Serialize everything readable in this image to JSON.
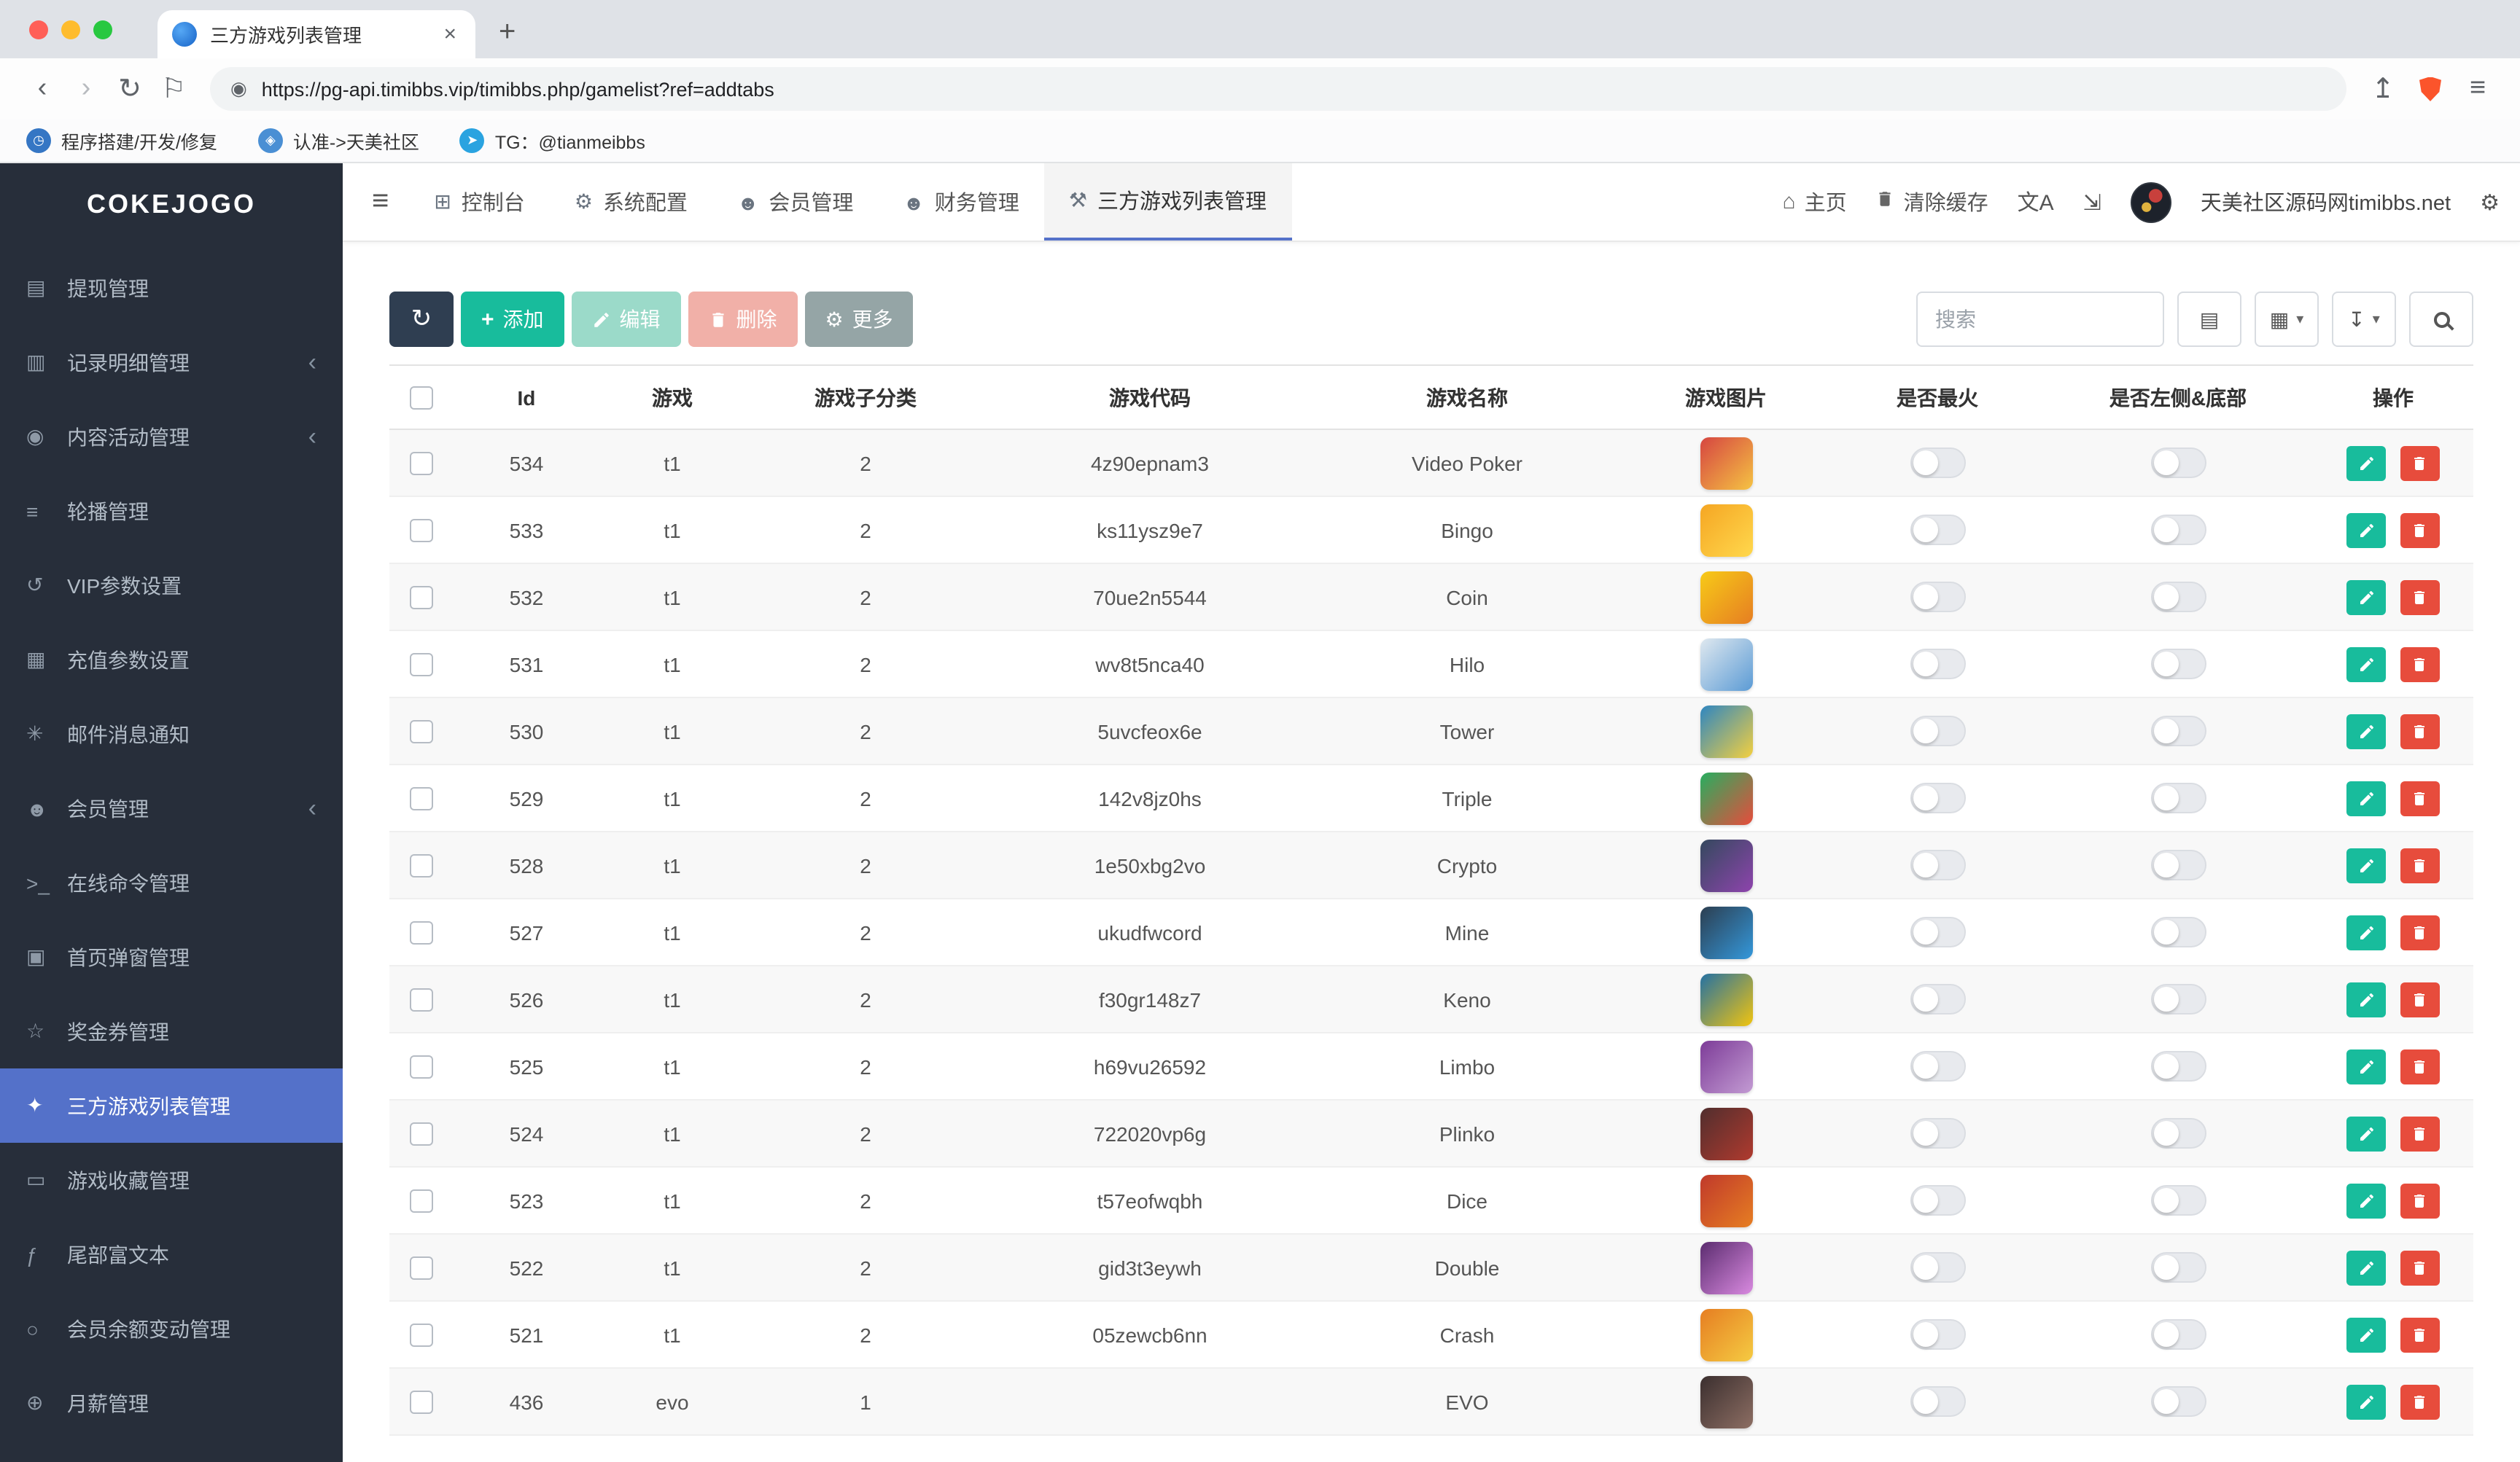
{
  "colors": {
    "accent": "#5471c9",
    "success": "#18bc9c",
    "success-light": "#9bdac9",
    "danger": "#e74c3c",
    "danger-light": "#f1b0a8",
    "gray-btn": "#95a5a6",
    "dark-btn": "#2f3e51",
    "sidebar-bg": "#272e3a",
    "traffic-red": "#ff5f57",
    "traffic-yellow": "#febc2e",
    "traffic-green": "#28c840",
    "shield-orange": "#fb542b"
  },
  "browser": {
    "tab_title": "三方游戏列表管理",
    "url": "https://pg-api.timibbs.vip/timibbs.php/gamelist?ref=addtabs",
    "bookmarks": [
      {
        "label": "程序搭建/开发/修复",
        "color": "#3576c4",
        "glyph": "◷"
      },
      {
        "label": "认准->天美社区",
        "color": "#4a8fd4",
        "glyph": "◈"
      },
      {
        "label": "TG：@tianmeibbs",
        "color": "#2aa3e0",
        "glyph": "➤"
      }
    ]
  },
  "sidebar": {
    "logo": "COKEJOGO",
    "items": [
      {
        "label": "提现管理",
        "icon": "withdraw-icon"
      },
      {
        "label": "记录明细管理",
        "icon": "records-icon",
        "chevron": true
      },
      {
        "label": "内容活动管理",
        "icon": "activity-icon",
        "chevron": true
      },
      {
        "label": "轮播管理",
        "icon": "carousel-icon"
      },
      {
        "label": "VIP参数设置",
        "icon": "vip-icon"
      },
      {
        "label": "充值参数设置",
        "icon": "recharge-icon"
      },
      {
        "label": "邮件消息通知",
        "icon": "mail-icon"
      },
      {
        "label": "会员管理",
        "icon": "members-icon",
        "chevron": true
      },
      {
        "label": "在线命令管理",
        "icon": "terminal-icon"
      },
      {
        "label": "首页弹窗管理",
        "icon": "popup-icon"
      },
      {
        "label": "奖金券管理",
        "icon": "coupon-icon"
      },
      {
        "label": "三方游戏列表管理",
        "icon": "games-icon",
        "active": true
      },
      {
        "label": "游戏收藏管理",
        "icon": "favorites-icon"
      },
      {
        "label": "尾部富文本",
        "icon": "richtext-icon"
      },
      {
        "label": "会员余额变动管理",
        "icon": "balance-icon"
      },
      {
        "label": "月薪管理",
        "icon": "salary-icon"
      }
    ]
  },
  "topnav": {
    "tabs": [
      {
        "label": "控制台",
        "icon": "dashboard-icon"
      },
      {
        "label": "系统配置",
        "icon": "gear-icon"
      },
      {
        "label": "会员管理",
        "icon": "users-icon"
      },
      {
        "label": "财务管理",
        "icon": "finance-icon"
      },
      {
        "label": "三方游戏列表管理",
        "icon": "wrench-icon",
        "active": true
      }
    ],
    "home": "主页",
    "clear_cache": "清除缓存",
    "user": "天美社区源码网timibbs.net"
  },
  "toolbar": {
    "add": "添加",
    "edit": "编辑",
    "delete": "删除",
    "more": "更多",
    "search_placeholder": "搜索"
  },
  "table": {
    "headers": [
      "Id",
      "游戏",
      "游戏子分类",
      "游戏代码",
      "游戏名称",
      "游戏图片",
      "是否最火",
      "是否左侧&底部",
      "操作"
    ],
    "rows": [
      {
        "id": 534,
        "game": "t1",
        "subcat": 2,
        "code": "4z90epnam3",
        "name": "Video Poker",
        "hot": false,
        "side": false,
        "img": [
          "#d64541",
          "#f5c343"
        ]
      },
      {
        "id": 533,
        "game": "t1",
        "subcat": 2,
        "code": "ks11ysz9e7",
        "name": "Bingo",
        "hot": false,
        "side": false,
        "img": [
          "#f5a623",
          "#ffd84d"
        ]
      },
      {
        "id": 532,
        "game": "t1",
        "subcat": 2,
        "code": "70ue2n5544",
        "name": "Coin",
        "hot": false,
        "side": false,
        "img": [
          "#f7ca18",
          "#e67e22"
        ]
      },
      {
        "id": 531,
        "game": "t1",
        "subcat": 2,
        "code": "wv8t5nca40",
        "name": "Hilo",
        "hot": false,
        "side": false,
        "img": [
          "#dfe8ef",
          "#5b9bd5"
        ]
      },
      {
        "id": 530,
        "game": "t1",
        "subcat": 2,
        "code": "5uvcfeox6e",
        "name": "Tower",
        "hot": false,
        "side": false,
        "img": [
          "#2e86c1",
          "#f4d03f"
        ]
      },
      {
        "id": 529,
        "game": "t1",
        "subcat": 2,
        "code": "142v8jz0hs",
        "name": "Triple",
        "hot": false,
        "side": false,
        "img": [
          "#27ae60",
          "#e74c3c"
        ]
      },
      {
        "id": 528,
        "game": "t1",
        "subcat": 2,
        "code": "1e50xbg2vo",
        "name": "Crypto",
        "hot": false,
        "side": false,
        "img": [
          "#34495e",
          "#8e44ad"
        ]
      },
      {
        "id": 527,
        "game": "t1",
        "subcat": 2,
        "code": "ukudfwcord",
        "name": "Mine",
        "hot": false,
        "side": false,
        "img": [
          "#2c3e50",
          "#3498db"
        ]
      },
      {
        "id": 526,
        "game": "t1",
        "subcat": 2,
        "code": "f30gr148z7",
        "name": "Keno",
        "hot": false,
        "side": false,
        "img": [
          "#2471a3",
          "#f1c40f"
        ]
      },
      {
        "id": 525,
        "game": "t1",
        "subcat": 2,
        "code": "h69vu26592",
        "name": "Limbo",
        "hot": false,
        "side": false,
        "img": [
          "#7d3c98",
          "#c39bd3"
        ]
      },
      {
        "id": 524,
        "game": "t1",
        "subcat": 2,
        "code": "722020vp6g",
        "name": "Plinko",
        "hot": false,
        "side": false,
        "img": [
          "#512e2e",
          "#b03a2e"
        ]
      },
      {
        "id": 523,
        "game": "t1",
        "subcat": 2,
        "code": "t57eofwqbh",
        "name": "Dice",
        "hot": false,
        "side": false,
        "img": [
          "#c0392b",
          "#e67e22"
        ]
      },
      {
        "id": 522,
        "game": "t1",
        "subcat": 2,
        "code": "gid3t3eywh",
        "name": "Double",
        "hot": false,
        "side": false,
        "img": [
          "#5b2c6f",
          "#d98ae0"
        ]
      },
      {
        "id": 521,
        "game": "t1",
        "subcat": 2,
        "code": "05zewcb6nn",
        "name": "Crash",
        "hot": false,
        "side": false,
        "img": [
          "#e67e22",
          "#f5cb42"
        ]
      },
      {
        "id": 436,
        "game": "evo",
        "subcat": 1,
        "code": "",
        "name": "EVO",
        "hot": false,
        "side": false,
        "img": [
          "#3b2f2f",
          "#8d6e63"
        ]
      }
    ]
  }
}
